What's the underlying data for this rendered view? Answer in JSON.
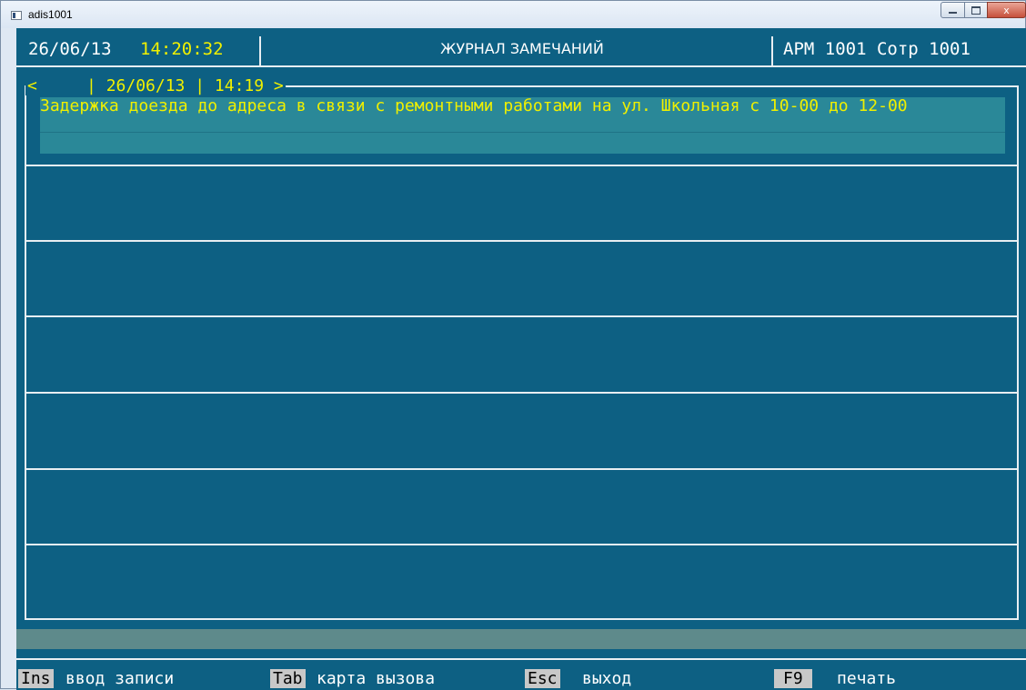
{
  "window": {
    "title": "adis1001",
    "close_glyph": "x"
  },
  "header": {
    "date": "26/06/13",
    "time": "14:20:32",
    "title": "ЖУРНАЛ ЗАМЕЧАНИЙ",
    "workstation": "АРМ 1001 Сотр 1001"
  },
  "record": {
    "nav": "<     | 26/06/13 | 14:19 >",
    "text": "Задержка доезда до адреса в связи с ремонтными работами на ул. Школьная с 10-00 до 12-00"
  },
  "function_keys": [
    {
      "key": "Ins",
      "label": "ввод записи"
    },
    {
      "key": "Tab",
      "label": "карта вызова"
    },
    {
      "key": "Esc",
      "label": "выход"
    },
    {
      "key": "F9",
      "label": "печать"
    }
  ],
  "colors": {
    "console_bg": "#0d6083",
    "highlight_text": "#f0f000",
    "record_bg": "#2a8898",
    "status_bar": "#5e8a8b",
    "key_bg": "#c8c8c8"
  }
}
